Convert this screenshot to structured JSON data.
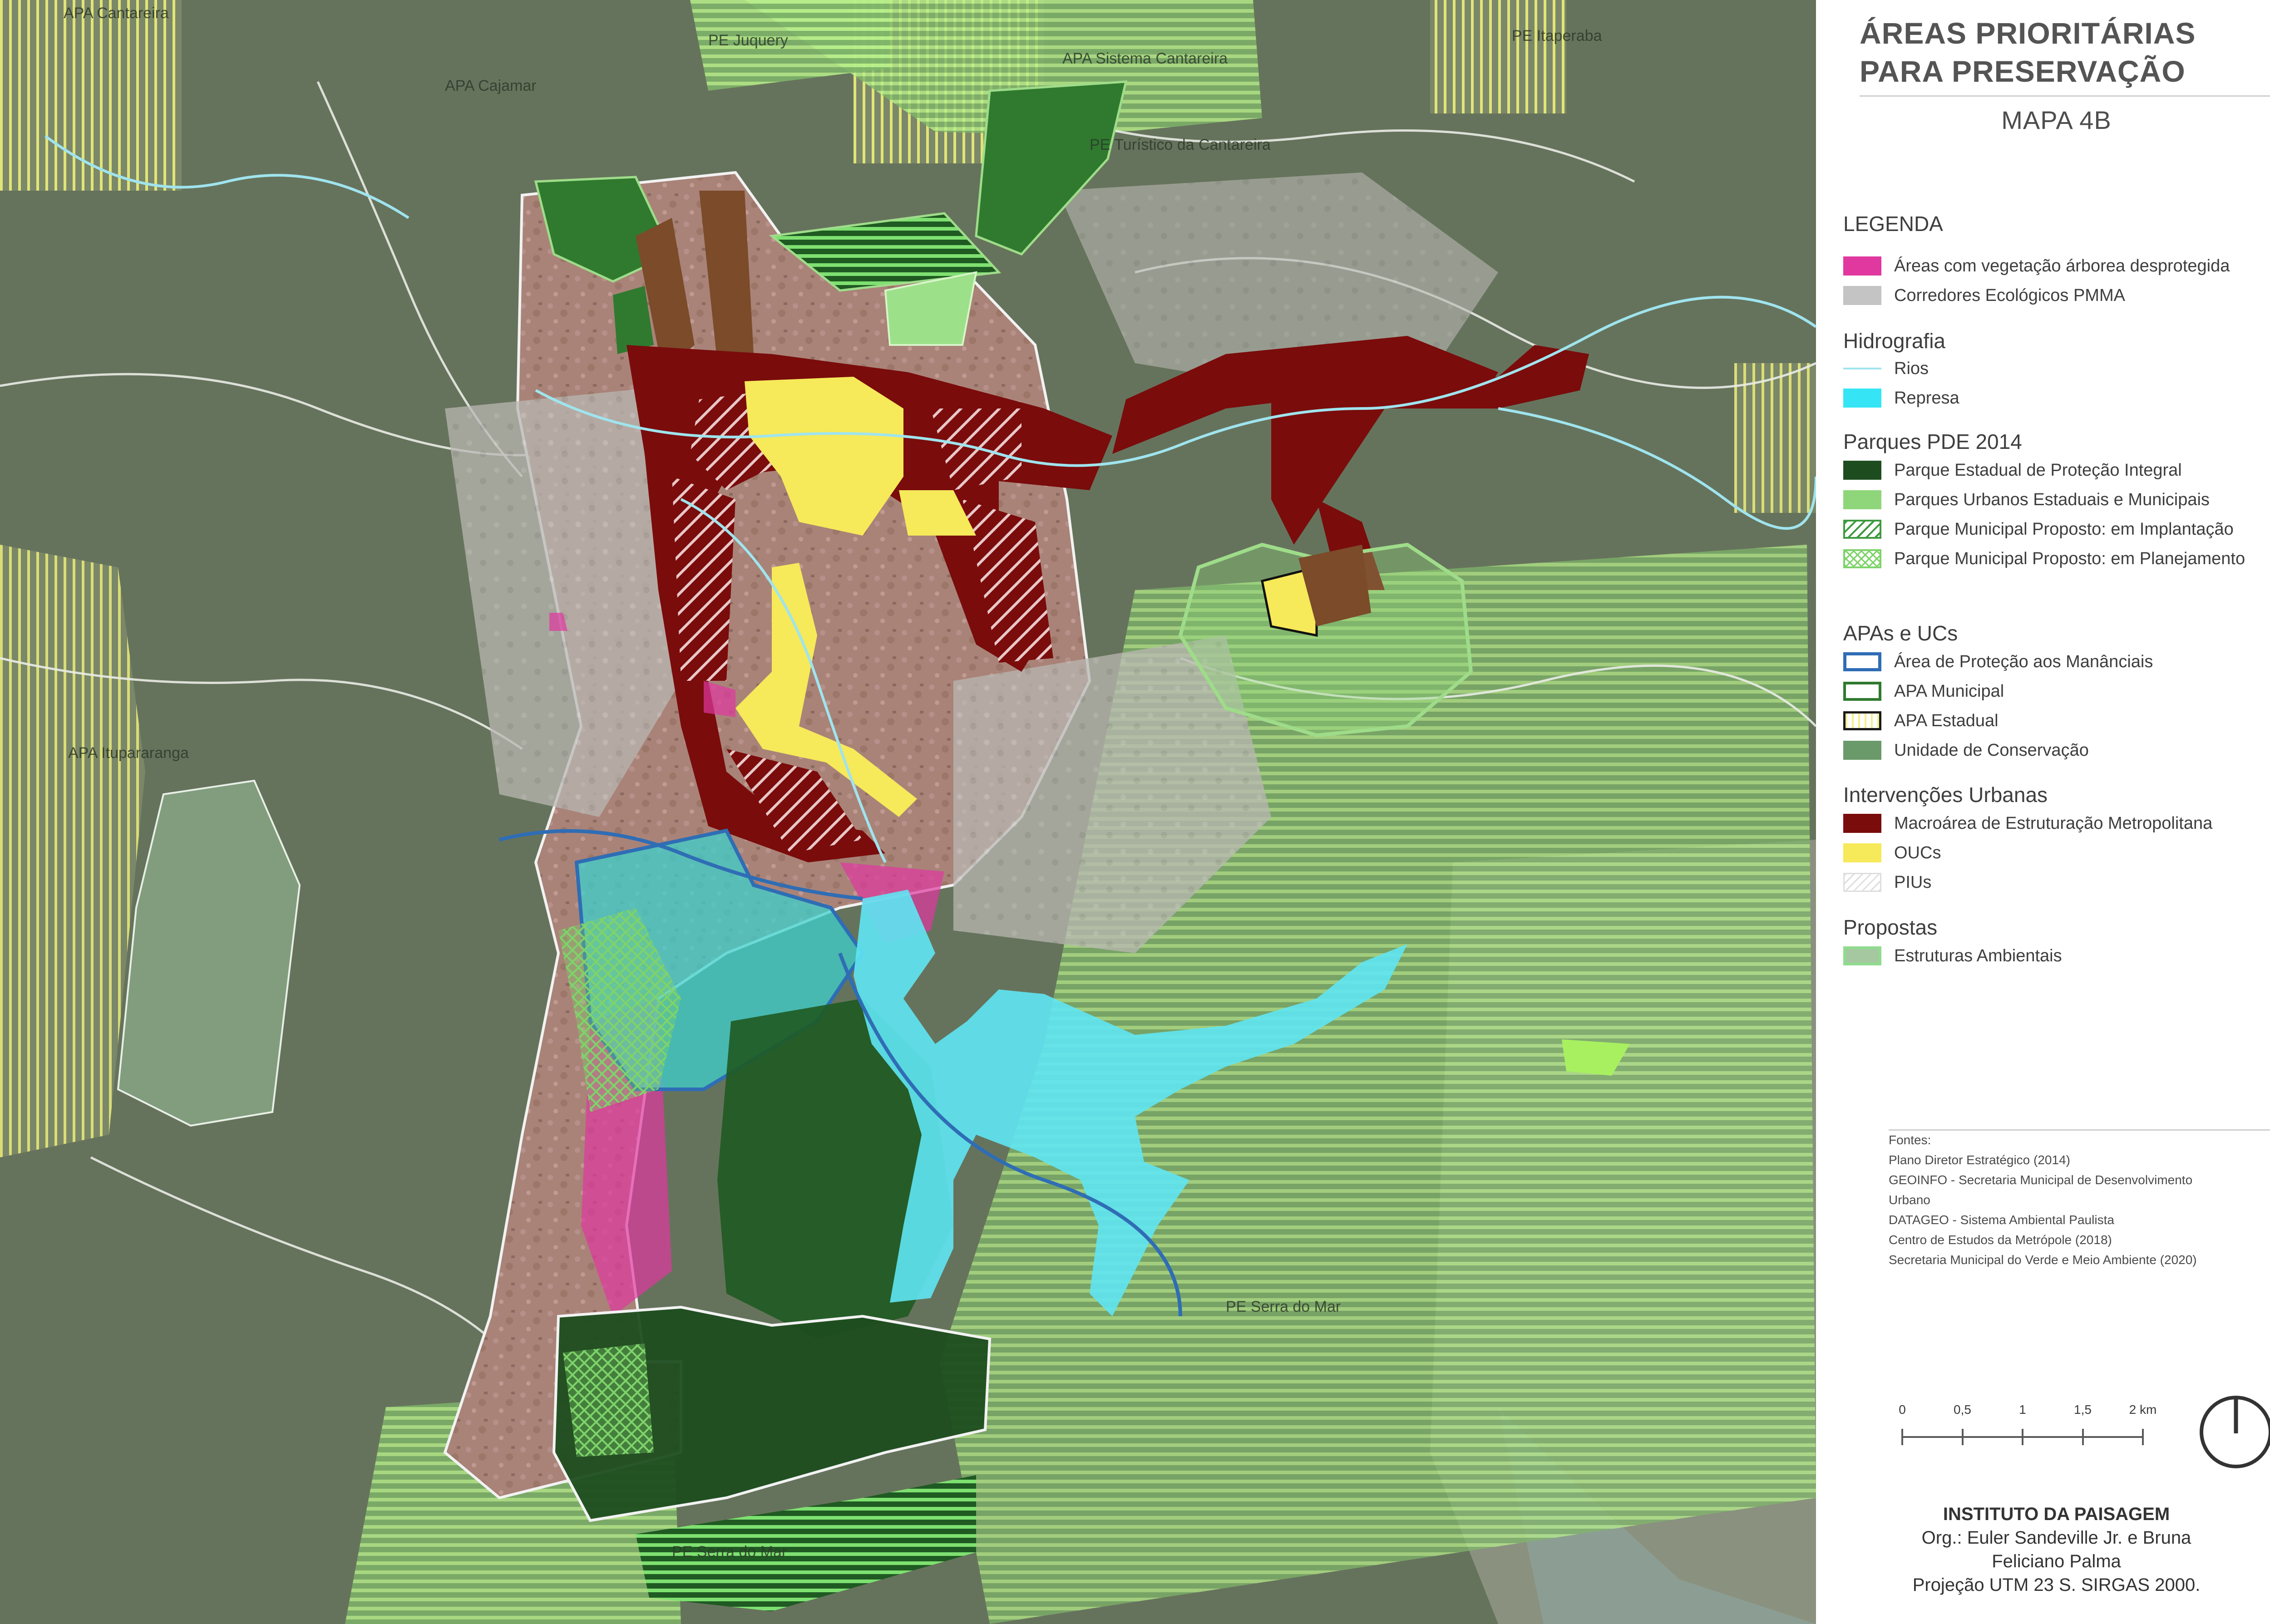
{
  "title": {
    "line1": "ÁREAS PRIORITÁRIAS",
    "line2": "PARA PRESERVAÇÃO",
    "map_number": "MAPA 4B"
  },
  "map_labels": {
    "apa_cantareira": "APA Cantareira",
    "pe_juquery": "PE Juquery",
    "apa_sistema_cantareira": "APA Sistema Cantareira",
    "pe_itaperaba": "PE Itaperaba",
    "apa_cajamar": "APA Cajamar",
    "pe_turistico": "PE Turístico da Cantareira",
    "apa_itupararanga": "APA Itupararanga",
    "pe_serra_do_mar_east": "PE Serra do Mar",
    "pe_serra_do_mar_south": "PE Serra do Mar"
  },
  "legend": {
    "heading": "LEGENDA",
    "general": [
      {
        "label": "Áreas com vegetação árborea desprotegida",
        "color": "#e0389f"
      },
      {
        "label": "Corredores Ecológicos PMMA",
        "color": "#c4c4c4"
      }
    ],
    "hydro_title": "Hidrografia",
    "hydro": [
      {
        "label": "Rios",
        "color": "#9fe4ee"
      },
      {
        "label": "Represa",
        "color": "#35e5f5"
      }
    ],
    "parks_title": "Parques PDE 2014",
    "parks": [
      {
        "label": "Parque Estadual de Proteção Integral",
        "color": "#1d4d1f"
      },
      {
        "label": "Parques Urbanos Estaduais e Municipais",
        "color": "#8fd67a"
      },
      {
        "label": "Parque Municipal Proposto: em Implantação",
        "color": "#3f9a3f"
      },
      {
        "label": "Parque Municipal Proposto: em Planejamento",
        "color": "#7ed36a"
      }
    ],
    "apa_title": "APAs e UCs",
    "apa": [
      {
        "label": "Área de Proteção aos Manânciais",
        "color": "#2f6db5"
      },
      {
        "label": "APA Municipal",
        "color": "#2f7a2f"
      },
      {
        "label": "APA Estadual",
        "color": "#f2f08a"
      },
      {
        "label": "Unidade de Conservação",
        "color": "#6a9a6a"
      }
    ],
    "urban_title": "Intervenções Urbanas",
    "urban": [
      {
        "label": "Macroárea de Estruturação Metropolitana",
        "color": "#7a0c0c"
      },
      {
        "label": "OUCs",
        "color": "#f6e95a"
      },
      {
        "label": "PIUs",
        "color": "#dedede"
      }
    ],
    "proposals_title": "Propostas",
    "proposals": [
      {
        "label": "Estruturas Ambientais",
        "color": "#8fdc8f"
      }
    ]
  },
  "sources": {
    "heading": "Fontes:",
    "lines": [
      "Plano Diretor Estratégico (2014)",
      "GEOINFO - Secretaria Municipal de Desenvolvimento",
      "Urbano",
      "DATAGEO - Sistema Ambiental Paulista",
      "Centro de Estudos da Metrópole (2018)",
      "Secretaria Municipal do Verde e Meio Ambiente (2020)"
    ]
  },
  "scale_bar": {
    "labels": [
      "0",
      "0,5",
      "1",
      "1,5",
      "2 km"
    ],
    "values_km": [
      0,
      0.5,
      1,
      1.5,
      2
    ]
  },
  "credits": {
    "institute": "INSTITUTO DA PAISAGEM",
    "org_line1": "Org.: Euler Sandeville Jr. e Bruna",
    "org_line2": "Feliciano Palma",
    "projection": "Projeção UTM 23 S. SIRGAS 2000."
  }
}
